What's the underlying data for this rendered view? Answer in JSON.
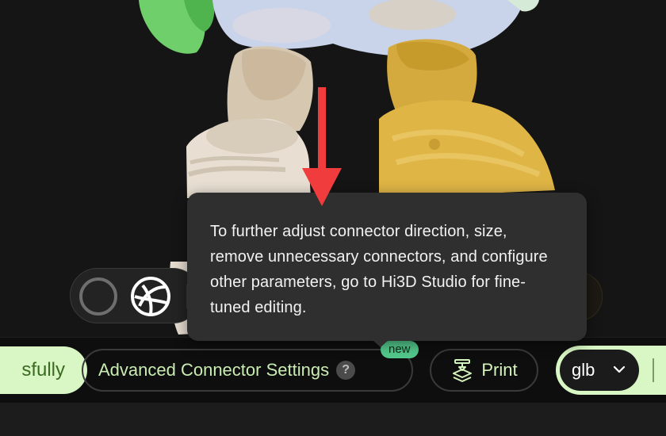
{
  "viewport": {
    "tooltip": {
      "text": "To further adjust connector direction, size, remove unnecessary connectors, and configure other parameters, go to Hi3D Studio for fine-tuned editing."
    },
    "controls": [
      {
        "name": "loading",
        "icon": "loading-ring-icon"
      },
      {
        "name": "view-mode",
        "icon": "sphere-icon"
      }
    ]
  },
  "toolbar": {
    "status_label": "sfully",
    "advanced_label": "Advanced Connector Settings",
    "help_icon": "?",
    "new_badge": "new",
    "print_label": "Print",
    "format_value": "glb"
  },
  "colors": {
    "accent_green": "#d8f7c4",
    "badge_green": "#53c98c",
    "annotation_red": "#f03c3c",
    "tooltip_bg": "#2f2f2f"
  }
}
